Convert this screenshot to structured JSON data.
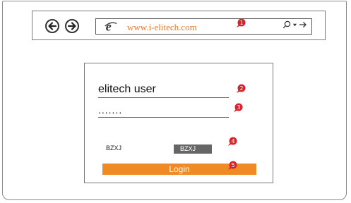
{
  "browser": {
    "url": "www.i-elitech.com",
    "search_symbol": "⌕",
    "dropdown_symbol": "▾",
    "go_symbol": "→"
  },
  "login": {
    "username_value": "elitech user",
    "password_value": ".......",
    "captcha_label": "BZXJ",
    "captcha_code": "BZXJ",
    "login_label": "Login"
  },
  "markers": [
    "1",
    "2",
    "3",
    "4",
    "5"
  ],
  "colors": {
    "accent_orange": "#f08a24",
    "marker_red": "#d8232a",
    "url_text": "#e8782a"
  },
  "icons": [
    "back-arrow-icon",
    "forward-arrow-icon",
    "ie-browser-icon",
    "search-icon",
    "chevron-down-icon",
    "go-arrow-icon",
    "pin-marker-icon"
  ]
}
